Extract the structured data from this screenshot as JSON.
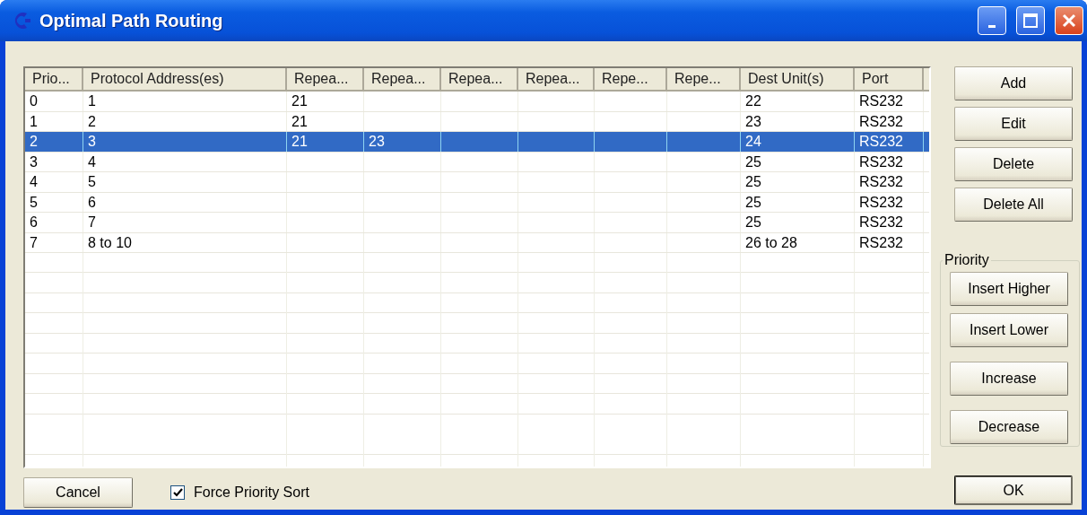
{
  "window": {
    "title": "Optimal Path Routing"
  },
  "table": {
    "columns": [
      "Prio...",
      "Protocol Address(es)",
      "Repea...",
      "Repea...",
      "Repea...",
      "Repea...",
      "Repe...",
      "Repe...",
      "Dest Unit(s)",
      "Port"
    ],
    "rows": [
      {
        "selected": false,
        "cells": [
          "0",
          "1",
          "21",
          "",
          "",
          "",
          "",
          "",
          "22",
          "RS232"
        ]
      },
      {
        "selected": false,
        "cells": [
          "1",
          "2",
          "21",
          "",
          "",
          "",
          "",
          "",
          "23",
          "RS232"
        ]
      },
      {
        "selected": true,
        "cells": [
          "2",
          "3",
          "21",
          "23",
          "",
          "",
          "",
          "",
          "24",
          "RS232"
        ]
      },
      {
        "selected": false,
        "cells": [
          "3",
          "4",
          "",
          "",
          "",
          "",
          "",
          "",
          "25",
          "RS232"
        ]
      },
      {
        "selected": false,
        "cells": [
          "4",
          "5",
          "",
          "",
          "",
          "",
          "",
          "",
          "25",
          "RS232"
        ]
      },
      {
        "selected": false,
        "cells": [
          "5",
          "6",
          "",
          "",
          "",
          "",
          "",
          "",
          "25",
          "RS232"
        ]
      },
      {
        "selected": false,
        "cells": [
          "6",
          "7",
          "",
          "",
          "",
          "",
          "",
          "",
          "25",
          "RS232"
        ]
      },
      {
        "selected": false,
        "cells": [
          "7",
          "8 to 10",
          "",
          "",
          "",
          "",
          "",
          "",
          "26 to 28",
          "RS232"
        ]
      }
    ]
  },
  "side_buttons": [
    "Add",
    "Edit",
    "Delete",
    "Delete All"
  ],
  "priority_group": {
    "title": "Priority",
    "buttons": [
      "Insert Higher",
      "Insert Lower",
      "Increase",
      "Decrease"
    ]
  },
  "cancel_button": "Cancel",
  "force_priority_sort": {
    "label": "Force Priority Sort",
    "checked": true
  },
  "ok_button": "OK"
}
